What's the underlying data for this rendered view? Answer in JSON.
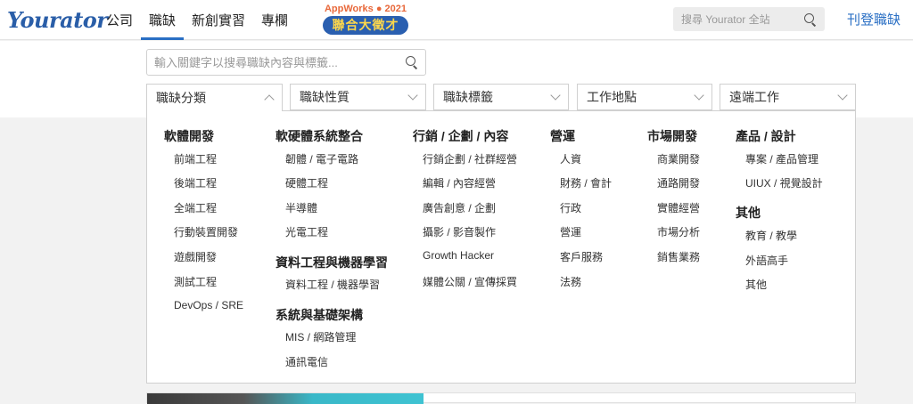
{
  "header": {
    "logo_text": "Yourator",
    "nav": [
      {
        "label": "公司"
      },
      {
        "label": "職缺",
        "active": true
      },
      {
        "label": "新創實習"
      },
      {
        "label": "專欄"
      }
    ],
    "promo": {
      "top": "AppWorks ● 2021",
      "badge": "聯合大徵才"
    },
    "search_placeholder": "搜尋 Yourator 全站",
    "post_job": "刊登職缺"
  },
  "filters": {
    "keyword_placeholder": "輸入關鍵字以搜尋職缺內容與標籤...",
    "dropdowns": [
      "職缺分類",
      "職缺性質",
      "職缺標籤",
      "工作地點",
      "遠端工作"
    ]
  },
  "panel": {
    "groups": {
      "software": {
        "title": "軟體開發",
        "items": [
          "前端工程",
          "後端工程",
          "全端工程",
          "行動裝置開發",
          "遊戲開發",
          "測試工程",
          "DevOps / SRE"
        ]
      },
      "hardware": {
        "title": "軟硬體系統整合",
        "items": [
          "韌體 / 電子電路",
          "硬體工程",
          "半導體",
          "光電工程"
        ]
      },
      "data": {
        "title": "資料工程與機器學習",
        "items": [
          "資料工程 / 機器學習"
        ]
      },
      "infra": {
        "title": "系統與基礎架構",
        "items": [
          "MIS / 網路管理",
          "通訊電信"
        ]
      },
      "marketing": {
        "title": "行銷 / 企劃 / 內容",
        "items": [
          "行銷企劃 / 社群經營",
          "編輯 / 內容經營",
          "廣告創意 / 企劃",
          "攝影 / 影音製作",
          "Growth Hacker",
          "媒體公關 / 宣傳採買"
        ]
      },
      "operations": {
        "title": "營運",
        "items": [
          "人資",
          "財務 / 會計",
          "行政",
          "營運",
          "客戶服務",
          "法務"
        ]
      },
      "business": {
        "title": "市場開發",
        "items": [
          "商業開發",
          "通路開發",
          "實體經營",
          "市場分析",
          "銷售業務"
        ]
      },
      "product": {
        "title": "產品 / 設計",
        "items": [
          "專案 / 產品管理",
          "UIUX / 視覺設計"
        ]
      },
      "other": {
        "title": "其他",
        "items": [
          "教育 / 教學",
          "外語高手",
          "其他"
        ]
      }
    }
  }
}
